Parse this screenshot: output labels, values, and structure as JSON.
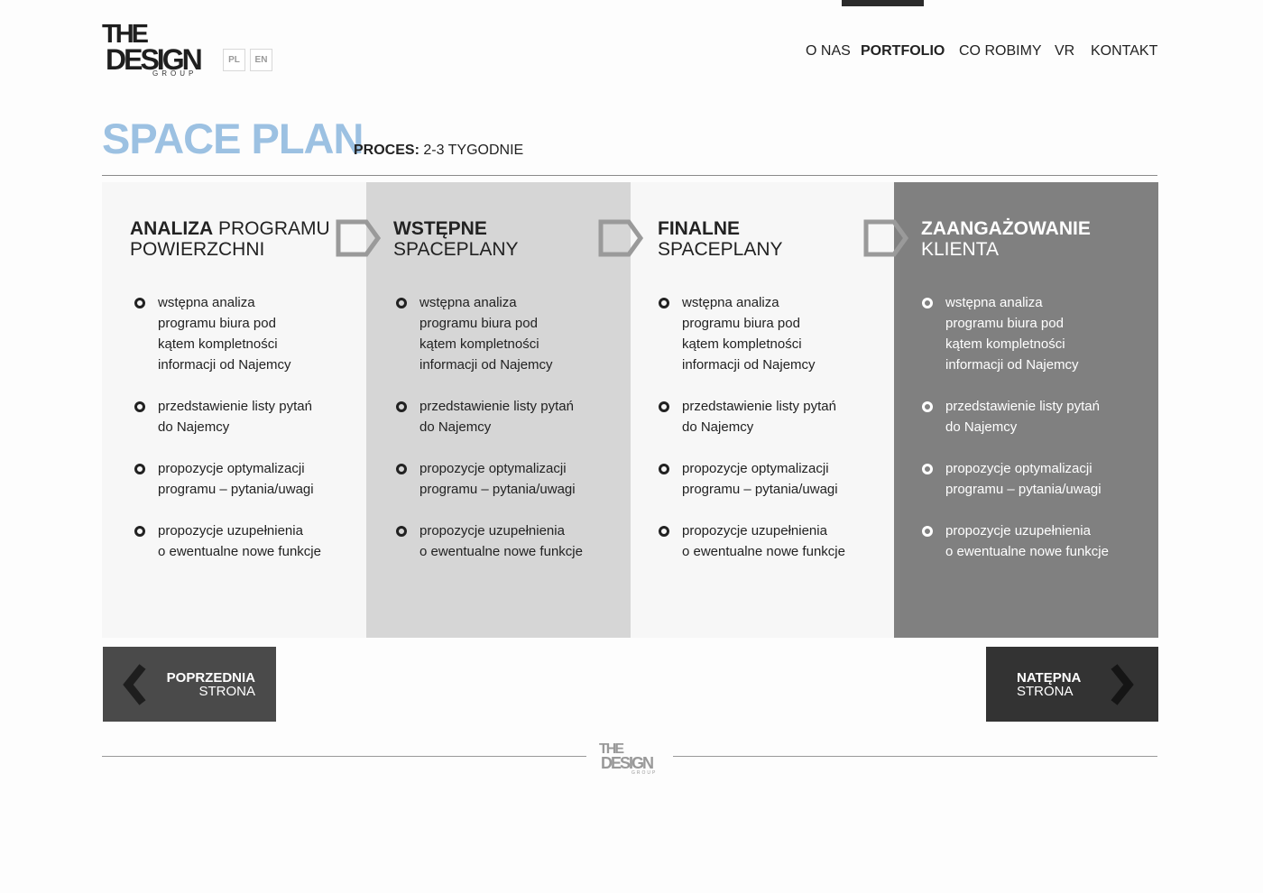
{
  "header": {
    "logo": {
      "line1": "THE",
      "line2": "DESIGN",
      "line3": "GROUP"
    },
    "languages": [
      "PL",
      "EN"
    ],
    "nav": [
      {
        "label": "O NAS",
        "active": false
      },
      {
        "label": "PORTFOLIO",
        "active": true
      },
      {
        "label": "CO ROBIMY",
        "active": false
      },
      {
        "label": "VR",
        "active": false
      },
      {
        "label": "KONTAKT",
        "active": false
      }
    ]
  },
  "page": {
    "title": "SPACE PLAN",
    "proces_label": "PROCES:",
    "proces_value": " 2-3 TYGODNIE"
  },
  "panels": [
    {
      "title_bold": "ANALIZA",
      "title_rest": " PROGRAMU",
      "title_line2": "POWIERZCHNI",
      "items": [
        [
          "wstępna analiza",
          "programu biura pod",
          "kątem kompletności",
          "informacji od Najemcy"
        ],
        [
          "przedstawienie listy pytań",
          "do Najemcy"
        ],
        [
          "propozycje optymalizacji",
          "programu – pytania/uwagi"
        ],
        [
          "propozycje uzupełnienia",
          "o ewentualne nowe funkcje"
        ]
      ]
    },
    {
      "title_bold": "WSTĘPNE",
      "title_rest": "",
      "title_line2": "SPACEPLANY",
      "items": [
        [
          "wstępna analiza",
          "programu biura pod",
          "kątem kompletności",
          "informacji od Najemcy"
        ],
        [
          "przedstawienie listy pytań",
          "do Najemcy"
        ],
        [
          "propozycje optymalizacji",
          "programu – pytania/uwagi"
        ],
        [
          "propozycje uzupełnienia",
          "o ewentualne nowe funkcje"
        ]
      ]
    },
    {
      "title_bold": "FINALNE",
      "title_rest": "",
      "title_line2": "SPACEPLANY",
      "items": [
        [
          "wstępna analiza",
          "programu biura pod",
          "kątem kompletności",
          "informacji od Najemcy"
        ],
        [
          "przedstawienie listy pytań",
          "do Najemcy"
        ],
        [
          "propozycje optymalizacji",
          "programu – pytania/uwagi"
        ],
        [
          "propozycje uzupełnienia",
          "o ewentualne nowe funkcje"
        ]
      ]
    },
    {
      "title_bold": "ZAANGAŻOWANIE",
      "title_rest": "",
      "title_line2": "KLIENTA",
      "items": [
        [
          "wstępna analiza",
          "programu biura pod",
          "kątem kompletności",
          "informacji od Najemcy"
        ],
        [
          "przedstawienie listy pytań",
          "do Najemcy"
        ],
        [
          "propozycje optymalizacji",
          "programu – pytania/uwagi"
        ],
        [
          "propozycje uzupełnienia",
          "o ewentualne nowe funkcje"
        ]
      ]
    }
  ],
  "pager": {
    "prev_line1": "POPRZEDNIA",
    "prev_line2": "STRONA",
    "next_line1": "NATĘPNA",
    "next_line2": "STRONA"
  },
  "footer": {
    "logo_line1": "THE",
    "logo_line2": "DESIGN",
    "logo_line3": "GROUP"
  },
  "colors": {
    "title_accent": "#9cc1e2",
    "panel_light": "#f7f7f7",
    "panel_mid": "#d6d6d6",
    "panel_dark": "#808080",
    "arrow_gray": "#9a9a9a"
  },
  "icons": [
    "chevron-left-icon",
    "chevron-right-icon",
    "step-arrow-icon",
    "bullet-circle-icon"
  ]
}
